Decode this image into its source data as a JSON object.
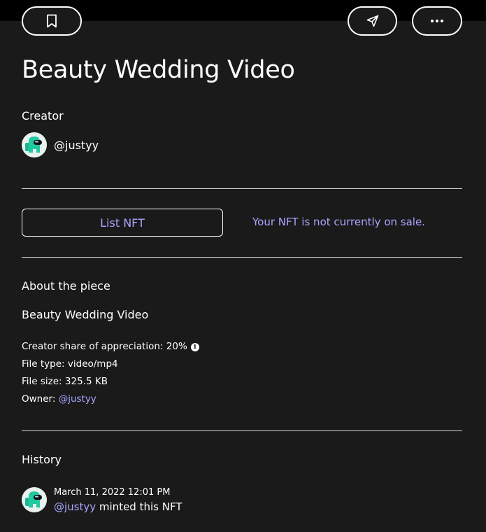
{
  "nft": {
    "title": "Beauty Wedding Video"
  },
  "creator": {
    "label": "Creator",
    "handle": "@justyy"
  },
  "actions": {
    "list_label": "List NFT",
    "sale_status": "Your NFT is not currently on sale."
  },
  "about": {
    "label": "About the piece",
    "piece_title": "Beauty Wedding Video",
    "creator_share": "Creator share of appreciation: 20%",
    "file_type": "File type: video/mp4",
    "file_size": "File size: 325.5 KB",
    "owner_label": "Owner:",
    "owner_handle": "@justyy"
  },
  "history": {
    "label": "History",
    "entries": [
      {
        "date": "March 11, 2022 12:01 PM",
        "user": "@justyy",
        "action": "minted this NFT"
      }
    ]
  },
  "icons": {
    "bookmark": "bookmark-icon",
    "share": "send-icon",
    "more": "more-horizontal-icon",
    "info": "info-icon",
    "avatar": "among-us-crewmate-avatar"
  },
  "colors": {
    "background": "#1a1a1a",
    "accent": "#a8a5ff",
    "text": "#ffffff"
  }
}
